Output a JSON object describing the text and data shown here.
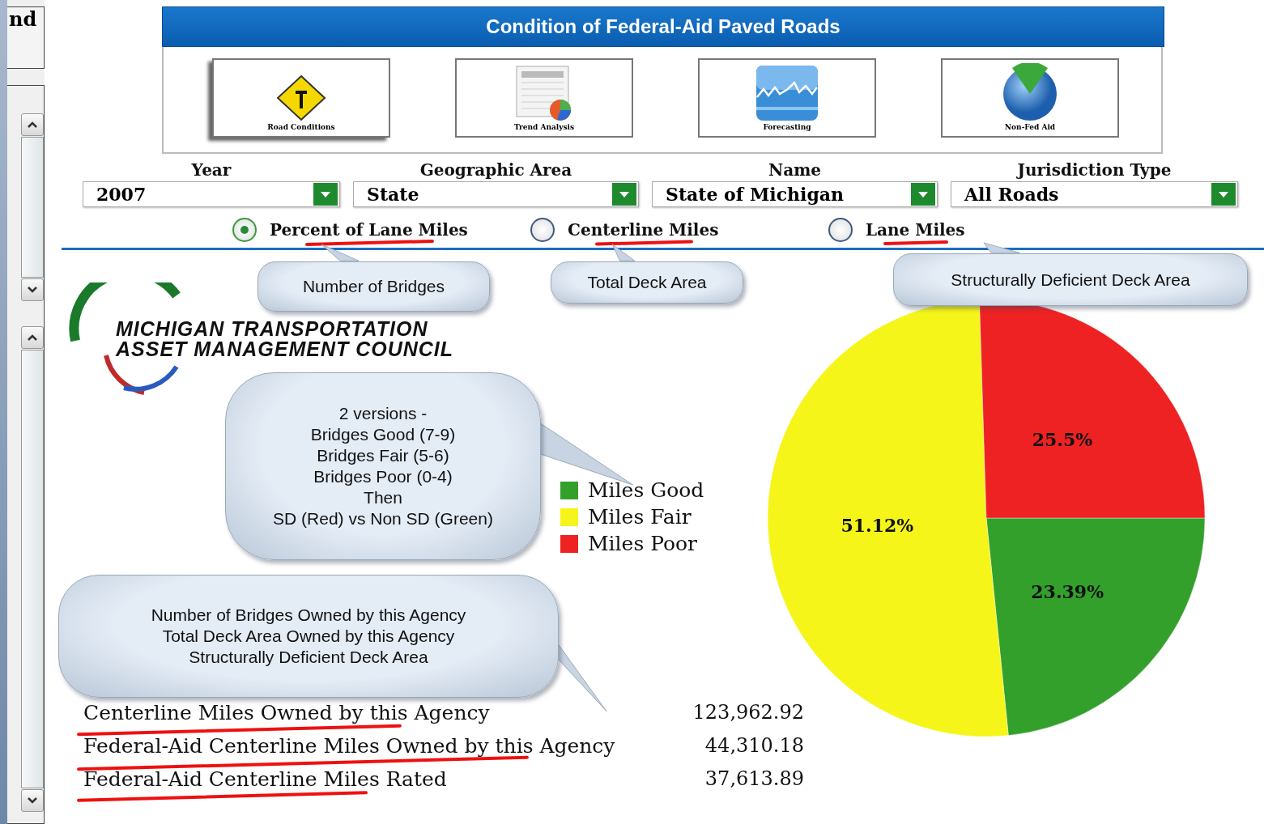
{
  "side_panel": {
    "title": "nd"
  },
  "header": {
    "title": "Condition of Federal-Aid Paved Roads"
  },
  "tiles": [
    {
      "kind": "sign",
      "label": "Road Conditions"
    },
    {
      "kind": "sheet",
      "label": "Trend Analysis"
    },
    {
      "kind": "graph",
      "label": "Forecasting"
    },
    {
      "kind": "globe",
      "label": "Non-Fed Aid"
    }
  ],
  "filters": [
    {
      "label": "Year",
      "value": "2007"
    },
    {
      "label": "Geographic Area",
      "value": "State"
    },
    {
      "label": "Name",
      "value": "State of Michigan"
    },
    {
      "label": "Jurisdiction Type",
      "value": "All Roads"
    }
  ],
  "measures": [
    {
      "label": "Percent of Lane Miles",
      "selected": true,
      "struck": true
    },
    {
      "label": "Centerline Miles",
      "selected": false,
      "struck": true
    },
    {
      "label": "Lane Miles",
      "selected": false,
      "struck": true
    }
  ],
  "logo": {
    "line_1": "MICHIGAN TRANSPORTATION",
    "line_2": "ASSET MANAGEMENT COUNCIL"
  },
  "legend": [
    {
      "color": "#33a02c"
    },
    {
      "color": "#f5f51a"
    },
    {
      "color": "#ee2222"
    }
  ],
  "stats": [
    {
      "label": "Centerline Miles Owned by this Agency",
      "value": "123,962.92",
      "struck": true
    },
    {
      "label": "Federal-Aid Centerline Miles Owned by this Agency",
      "value": "44,310.18",
      "struck": true
    },
    {
      "label": "Federal-Aid Centerline Miles Rated",
      "value": "37,613.89",
      "struck": true
    }
  ],
  "chart_data": {
    "type": "pie",
    "categories": [
      "Miles Good",
      "Miles Fair",
      "Miles Poor"
    ],
    "values": [
      23.39,
      51.12,
      25.5
    ],
    "data_labels": true,
    "value_labels": [
      "23.39%",
      "51.12%",
      "25.5%"
    ]
  },
  "callouts": [
    {
      "lines": [
        "Number of Bridges"
      ]
    },
    {
      "lines": [
        "Total Deck Area"
      ]
    },
    {
      "lines": [
        "Structurally Deficient Deck Area"
      ]
    },
    {
      "lines": [
        "2 versions -",
        "Bridges Good (7-9)",
        "Bridges Fair (5-6)",
        "Bridges Poor (0-4)",
        "Then",
        "SD (Red) vs Non SD (Green)"
      ]
    },
    {
      "lines": [
        "Number of Bridges Owned by this Agency",
        "Total Deck Area Owned by this Agency",
        "Structurally Deficient Deck Area"
      ]
    }
  ]
}
